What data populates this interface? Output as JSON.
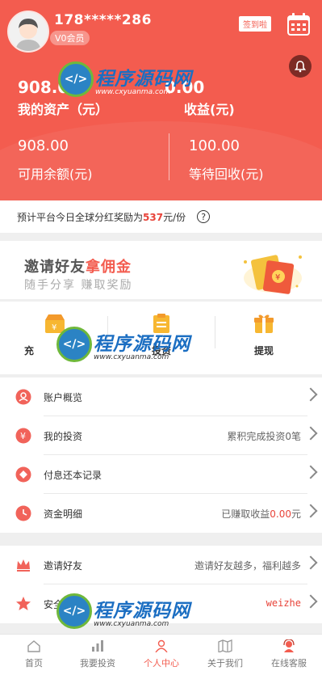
{
  "profile": {
    "phone": "178*****286",
    "level": "V0会员"
  },
  "header": {
    "sign_label": "签到啦"
  },
  "assets": {
    "total_value": "908.00",
    "total_label": "我的资产（元）",
    "earn_value": "0.00",
    "earn_label": "收益(元)"
  },
  "balance": {
    "available_value": "908.00",
    "available_label": "可用余额(元)",
    "pending_value": "100.00",
    "pending_label": "等待回收(元)"
  },
  "notice": {
    "prefix": "预计平台今日全球分红奖励为",
    "amount": "537",
    "suffix": "元/份",
    "help": "?"
  },
  "invite": {
    "title_a": "邀请好友",
    "title_b": "拿佣金",
    "subtitle": "随手分享 赚取奖励"
  },
  "ops": {
    "recharge_label": "充",
    "invest_label": "投资",
    "withdraw_label": "提现"
  },
  "menu1": [
    {
      "label": "账户概览",
      "right": ""
    },
    {
      "label": "我的投资",
      "right": "累积完成投资0笔"
    },
    {
      "label": "付息还本记录",
      "right": ""
    },
    {
      "label": "资金明细",
      "right_prefix": "已赚取收益",
      "right_value": "0.00",
      "right_suffix": "元"
    }
  ],
  "menu2": [
    {
      "label": "邀请好友",
      "right": "邀请好友越多，福利越多"
    },
    {
      "label": "安全",
      "right": "weizhe"
    }
  ],
  "watermark": {
    "text": "程序源码网",
    "url": "www.cxyuanma.com",
    "logo": "</>"
  },
  "tabs": [
    {
      "label": "首页",
      "icon": "home-icon"
    },
    {
      "label": "我要投资",
      "icon": "bars-icon"
    },
    {
      "label": "个人中心",
      "icon": "person-icon"
    },
    {
      "label": "关于我们",
      "icon": "map-icon"
    },
    {
      "label": "在线客服",
      "icon": "service-icon"
    }
  ],
  "colors": {
    "brand": "#f35c4f",
    "accent_red": "#e8443a"
  }
}
